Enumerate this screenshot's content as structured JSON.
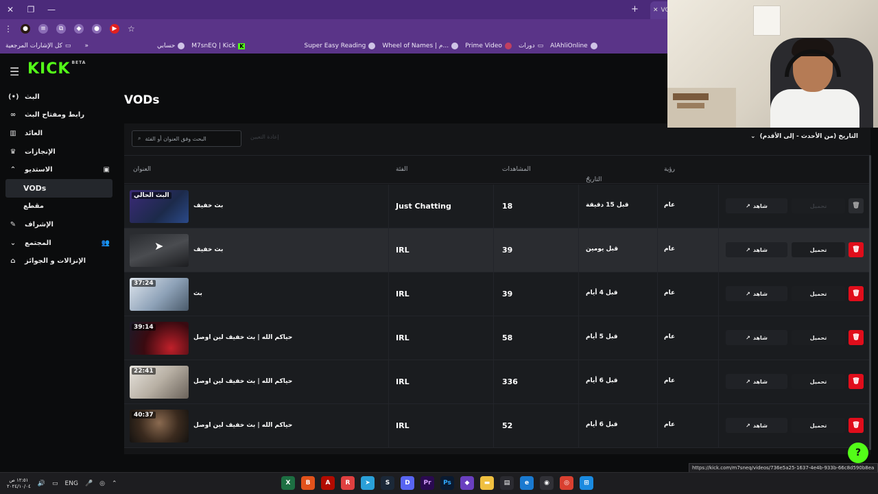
{
  "browser": {
    "tab_title": "VO",
    "bookmarks": [
      {
        "label": "كل الإشارات المرجعية",
        "icon": "folder-icon"
      },
      {
        "label": "حسابي",
        "icon": "globe-icon"
      },
      {
        "label": "M7snEQ | Kick",
        "icon": "globe-icon"
      },
      {
        "label": "Super Easy Reading",
        "icon": "globe-icon"
      },
      {
        "label": "Wheel of Names | م...",
        "icon": "globe-icon"
      },
      {
        "label": "Prime Video",
        "icon": "prime-icon"
      },
      {
        "label": "دورات",
        "icon": "folder-icon"
      },
      {
        "label": "AlAhliOnline",
        "icon": "globe-icon"
      }
    ]
  },
  "sidebar": {
    "logo": "KICK",
    "logo_badge": "BETA",
    "items": [
      {
        "label": "البث",
        "icon": "(•)"
      },
      {
        "label": "رابط ومفتاح البث",
        "icon": "🔗"
      },
      {
        "label": "العائد",
        "icon": "▦"
      },
      {
        "label": "الإنجازات",
        "icon": "🏆"
      },
      {
        "label": "الاستديو",
        "icon": "⌃"
      },
      {
        "label": "VODs",
        "icon": ""
      },
      {
        "label": "مقطع",
        "icon": ""
      },
      {
        "label": "الإشراف",
        "icon": "🔧"
      },
      {
        "label": "المجتمع",
        "icon": "⌄"
      },
      {
        "label": "الإنزالات و الجوائز",
        "icon": "🎁"
      }
    ]
  },
  "page": {
    "title": "VODs",
    "search_placeholder": "البحث وفق العنوان أو الفئة",
    "reset_label": "إعادة التعيين",
    "sort_label": "التاريخ (من الأحدث - إلى الأقدم)"
  },
  "table": {
    "headers": {
      "title": "العنوان",
      "category": "الفئة",
      "views": "المشاهدات",
      "date": "التاريخ",
      "visibility": "رؤية"
    },
    "watch_label": "شاهد",
    "download_label": "تحميل",
    "rows": [
      {
        "thumb_text": "البث الحالي",
        "title": "بث خفيف",
        "category": "Just Chatting",
        "views": "18",
        "date": "قبل 15 دقيقة",
        "visibility": "عام"
      },
      {
        "thumb_text": "",
        "title": "بث خفيف",
        "category": "IRL",
        "views": "39",
        "date": "قبل يومين",
        "visibility": "عام"
      },
      {
        "thumb_text": "37:24",
        "title": "بث",
        "category": "IRL",
        "views": "39",
        "date": "قبل 4 أيام",
        "visibility": "عام"
      },
      {
        "thumb_text": "39:14",
        "title": "حياكم الله | بث خفيف لين اوصل",
        "category": "IRL",
        "views": "58",
        "date": "قبل 5 أيام",
        "visibility": "عام"
      },
      {
        "thumb_text": "22:41",
        "title": "حياكم الله | بث خفيف لين اوصل",
        "category": "IRL",
        "views": "336",
        "date": "قبل 6 أيام",
        "visibility": "عام"
      },
      {
        "thumb_text": "40:37",
        "title": "حياكم الله | بث خفيف لين اوصل",
        "category": "IRL",
        "views": "52",
        "date": "قبل 6 أيام",
        "visibility": "عام"
      }
    ]
  },
  "status_url": "https://kick.com/m7sneq/videos/736e5a25-1637-4e4b-933b-66c8d590b8ea",
  "taskbar": {
    "time": "١٢:٥١ ص",
    "date": "٢٠٢٤/١٠/٠٤",
    "lang": "ENG"
  },
  "colors": {
    "accent": "#53fc18",
    "danger": "#e00d1b",
    "browser": "#5a3488"
  }
}
